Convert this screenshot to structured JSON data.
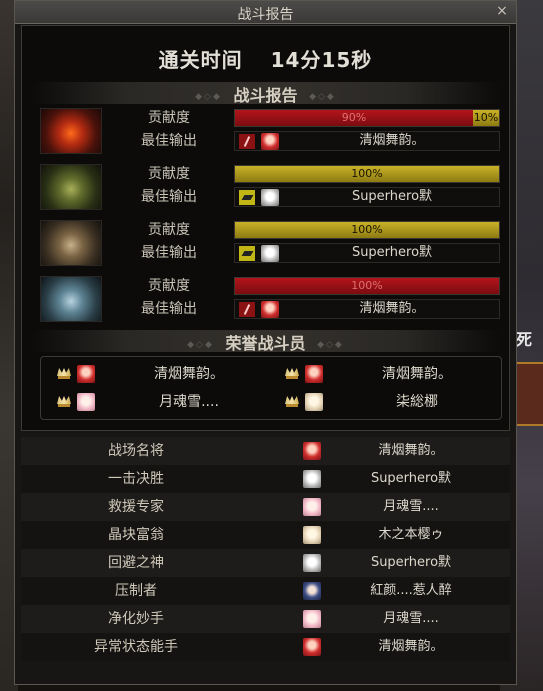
{
  "window": {
    "title": "战斗报告",
    "close_label": "×"
  },
  "clear_time": {
    "label": "通关时间",
    "value": "14分15秒"
  },
  "section_report": "战斗报告",
  "section_honor": "荣誉战斗员",
  "labels": {
    "contribution": "贡献度",
    "best_output": "最佳输出"
  },
  "players": [
    {
      "avatar": "fire-helmet-icon",
      "segments": [
        {
          "pct": "90%",
          "fraction": 0.9,
          "color": "#b3151b"
        },
        {
          "pct": "10%",
          "fraction": 0.1,
          "color": "#c9b128"
        }
      ],
      "weapon": "red-weapon-icon",
      "best_face": "red-hair-face",
      "best_name": "清烟舞韵。"
    },
    {
      "avatar": "green-helmet-icon",
      "segments": [
        {
          "pct": "100%",
          "fraction": 1.0,
          "color": "#c9b128"
        }
      ],
      "weapon": "yellow-weapon-icon",
      "best_face": "white-hair-face",
      "best_name": "Superhero默"
    },
    {
      "avatar": "bronze-helmet-icon",
      "segments": [
        {
          "pct": "100%",
          "fraction": 1.0,
          "color": "#c9b128"
        }
      ],
      "weapon": "yellow-weapon-icon",
      "best_face": "white-hair-face",
      "best_name": "Superhero默"
    },
    {
      "avatar": "ice-helmet-icon",
      "segments": [
        {
          "pct": "100%",
          "fraction": 1.0,
          "color": "#b3151b"
        }
      ],
      "weapon": "red-weapon-icon",
      "best_face": "red-hair-face",
      "best_name": "清烟舞韵。"
    }
  ],
  "honor": [
    {
      "name": "清烟舞韵。",
      "face": "red-hair-face"
    },
    {
      "name": "清烟舞韵。",
      "face": "red-hair-face"
    },
    {
      "name": "月魂雪....",
      "face": "pink-hair-face"
    },
    {
      "name": "柒総梛",
      "face": "light-hair-face"
    }
  ],
  "stats": [
    {
      "title": "战场名将",
      "name": "清烟舞韵。",
      "face": "red-hair-face"
    },
    {
      "title": "一击决胜",
      "name": "Superhero默",
      "face": "white-hair-face"
    },
    {
      "title": "救援专家",
      "name": "月魂雪....",
      "face": "pink-hair-face"
    },
    {
      "title": "晶块富翁",
      "name": "木之本樱ゥ",
      "face": "light-hair-face"
    },
    {
      "title": "回避之神",
      "name": "Superhero默",
      "face": "white-hair-face"
    },
    {
      "title": "压制者",
      "name": "紅颜....惹人醉",
      "face": "blue-hair-face"
    },
    {
      "title": "净化妙手",
      "name": "月魂雪....",
      "face": "pink-hair-face"
    },
    {
      "title": "异常状态能手",
      "name": "清烟舞韵。",
      "face": "red-hair-face"
    }
  ],
  "background": {
    "right_text": "至死"
  }
}
